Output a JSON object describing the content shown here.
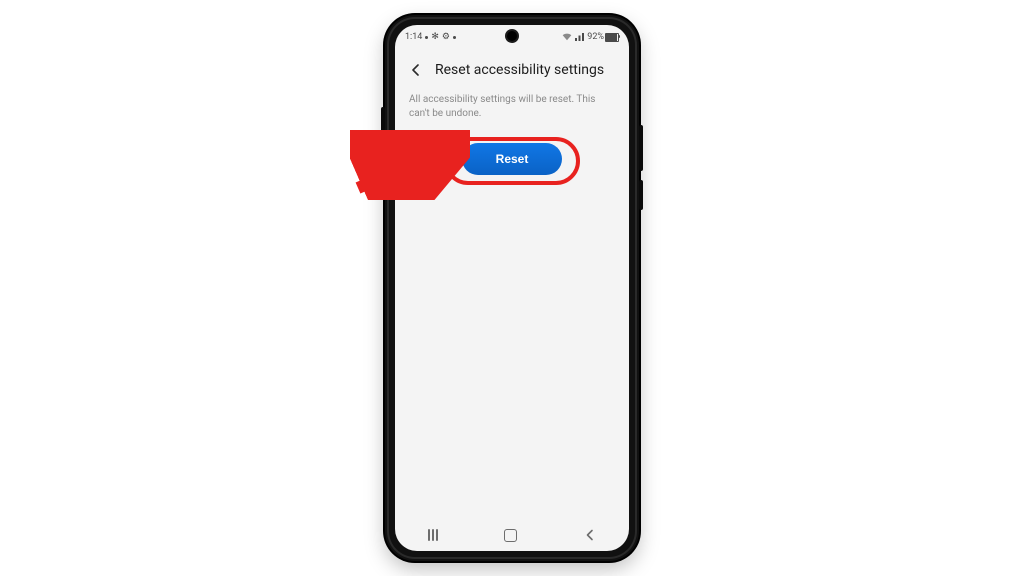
{
  "status_bar": {
    "time": "1:14",
    "battery_pct": "92%"
  },
  "header": {
    "title": "Reset accessibility settings"
  },
  "body": {
    "description": "All accessibility settings will be reset. This can't be undone.",
    "reset_button_label": "Reset"
  },
  "annotation": {
    "arrow_target": "reset-button"
  }
}
